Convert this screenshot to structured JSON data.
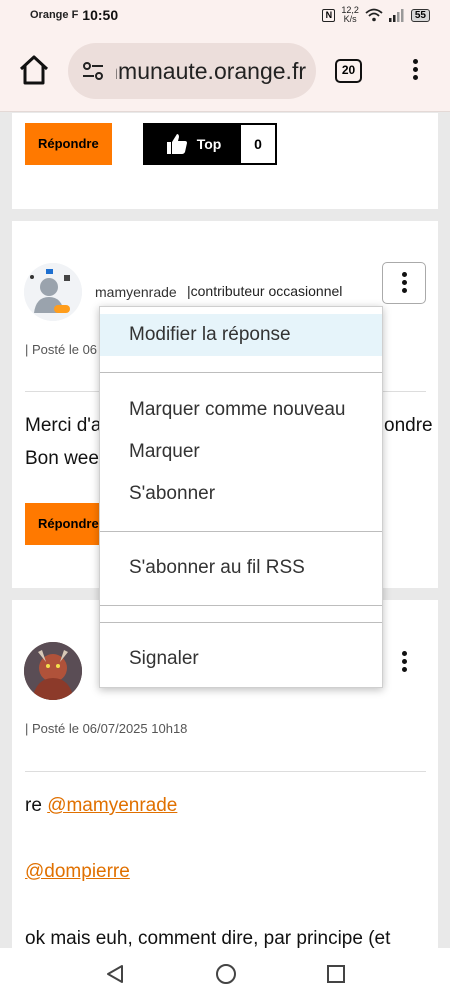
{
  "status_bar": {
    "carrier": "Orange F",
    "time": "10:50",
    "nfc": "N",
    "speed_value": "12,2",
    "speed_unit": "K/s",
    "battery": "55"
  },
  "browser": {
    "url": "communaute.orange.fr",
    "tab_count": "20"
  },
  "post_top": {
    "reply_label": "Répondre",
    "top_label": "Top",
    "top_count": "0"
  },
  "post_1": {
    "username": "mamyenrade",
    "role": "|contributeur occasionnel",
    "posted": "| Posté le 06",
    "line1_start": "Merci d'a",
    "line1_end": "ondre",
    "line2_start": "Bon wee",
    "reply_label": "Répondre"
  },
  "post_2": {
    "posted": "| Posté le 06/07/2025 10h18",
    "text_prefix": "re ",
    "mention1": "@mamyenrade",
    "mention2": "@dompierre",
    "text_line": "ok mais euh, comment dire, par principe (et"
  },
  "dropdown": {
    "edit": "Modifier la réponse",
    "mark_new": "Marquer comme nouveau",
    "mark": "Marquer",
    "subscribe": "S'abonner",
    "rss": "S'abonner au fil RSS",
    "report": "Signaler"
  },
  "colors": {
    "accent": "#ff7900",
    "highlight": "#e6f4fa"
  }
}
